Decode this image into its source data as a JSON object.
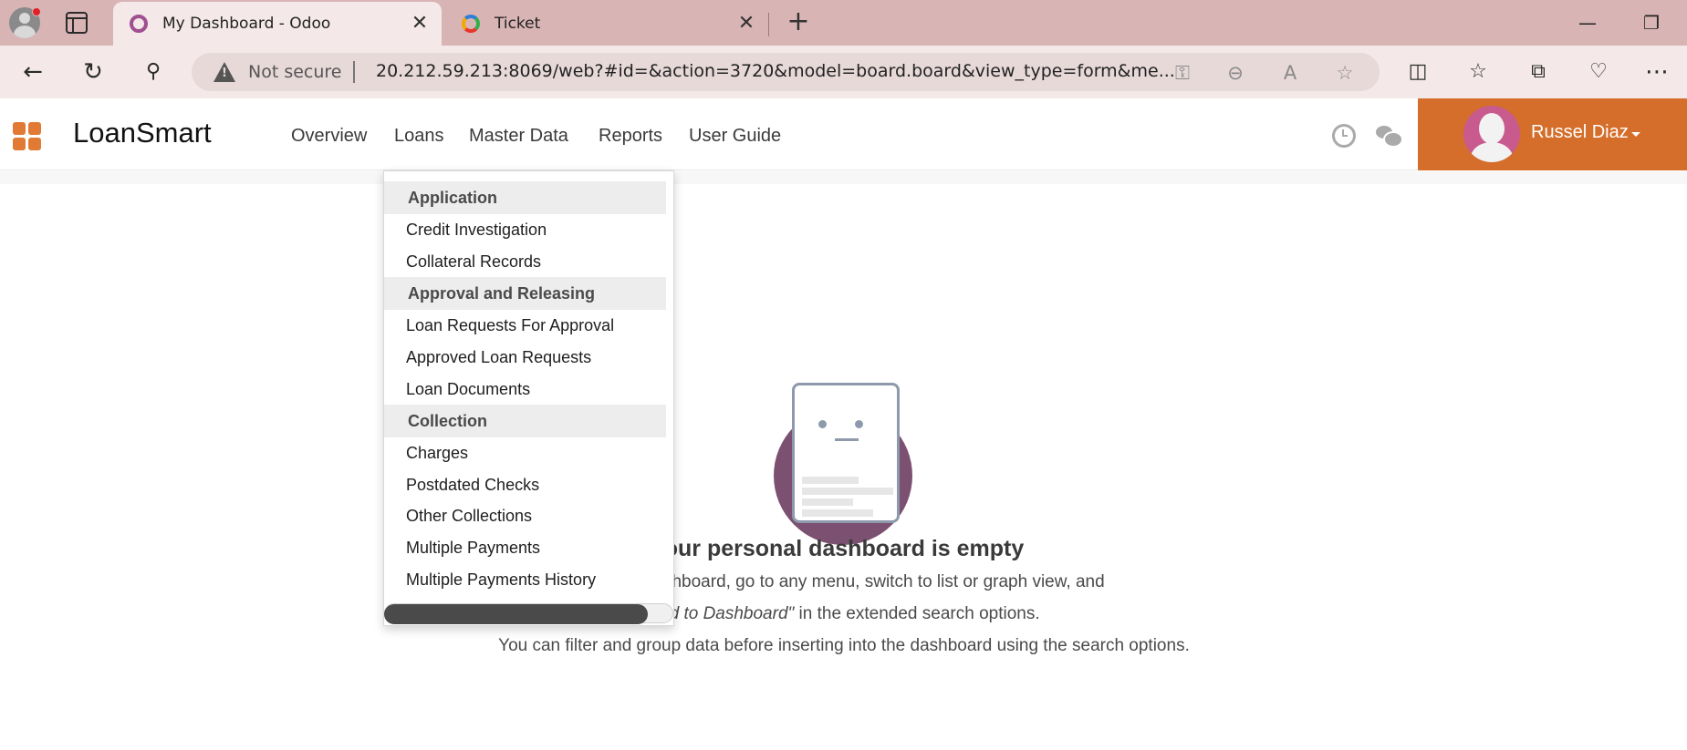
{
  "browser": {
    "tabs": [
      {
        "title": "My Dashboard - Odoo",
        "active": true
      },
      {
        "title": "Ticket",
        "active": false
      }
    ],
    "address": {
      "security_label": "Not secure",
      "url": "20.212.59.213:8069/web?#id=&action=3720&model=board.board&view_type=form&me..."
    }
  },
  "app": {
    "brand": "LoanSmart",
    "menu": [
      "Overview",
      "Loans",
      "Master Data",
      "Reports",
      "User Guide"
    ],
    "user_name": "Russel Diaz",
    "accent_color": "#d46e2a"
  },
  "loans_menu": {
    "sections": [
      {
        "header": "Application",
        "items": [
          "Credit Investigation",
          "Collateral Records"
        ]
      },
      {
        "header": "Approval and Releasing",
        "items": [
          "Loan Requests For Approval",
          "Approved Loan Requests",
          "Loan Documents"
        ]
      },
      {
        "header": "Collection",
        "items": [
          "Charges",
          "Postdated Checks",
          "Other Collections",
          "Multiple Payments",
          "Multiple Payments History"
        ]
      }
    ]
  },
  "dashboard": {
    "title": "our personal dashboard is empty",
    "line1": "nto this dashboard, go to any menu, switch to list or graph view, and",
    "line2_italic": "Add to Dashboard\"",
    "line2_rest": " in the extended search options.",
    "line3": "You can filter and group data before inserting into the dashboard using the search options."
  }
}
